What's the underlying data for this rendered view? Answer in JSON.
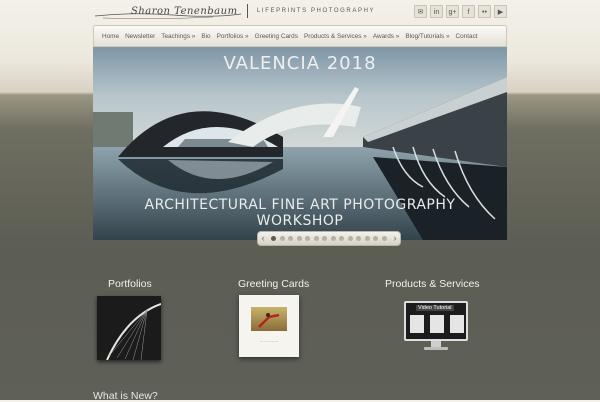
{
  "header": {
    "signature": "Sharon Tenenbaum",
    "tagline": "LIFEPRINTS PHOTOGRAPHY",
    "social_icons": [
      "mail-icon",
      "linkedin-icon",
      "googleplus-icon",
      "facebook-icon",
      "flickr-icon",
      "youtube-icon"
    ],
    "social_glyphs": [
      "✉",
      "in",
      "g+",
      "f",
      "••",
      "▶"
    ]
  },
  "nav": {
    "items": [
      "Home",
      "Newsletter",
      "Teachings »",
      "Bio",
      "Portfolios »",
      "Greeting Cards",
      "Products & Services »",
      "Awards »",
      "Blog/Tutorials »",
      "Contact"
    ]
  },
  "hero": {
    "title": "VALENCIA 2018",
    "subtitle": "ARCHITECTURAL FINE ART PHOTOGRAPHY WORKSHOP",
    "slide_count": 14,
    "active_slide": 1,
    "prev_glyph": "‹",
    "next_glyph": "›"
  },
  "sections": {
    "portfolios": {
      "title": "Portfolios"
    },
    "greeting_cards": {
      "title": "Greeting Cards"
    },
    "products": {
      "title": "Products & Services",
      "thumb_label": "Video Tutorial"
    },
    "whats_new": {
      "title": "What is New?"
    }
  },
  "colors": {
    "nav_bg": "#f2efe8",
    "page_bg": "#5f6058",
    "accent_text": "#f2f2ee"
  }
}
